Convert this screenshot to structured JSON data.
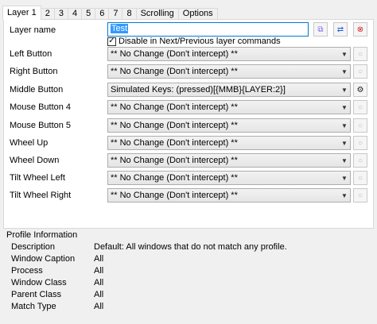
{
  "tabs": [
    "Layer 1",
    "2",
    "3",
    "4",
    "5",
    "6",
    "7",
    "8",
    "Scrolling",
    "Options"
  ],
  "layer_name": {
    "label": "Layer name",
    "value": "Test"
  },
  "disable_checkbox": {
    "label": "Disable in Next/Previous layer commands",
    "checked": "✓"
  },
  "icons": {
    "copy": "⧉",
    "swap": "⇄",
    "remove": "⊗",
    "gear": "⚙",
    "settings_dim": "○",
    "dropdown": "▼"
  },
  "buttons": [
    {
      "label": "Left Button",
      "value": "** No Change (Don't intercept) **"
    },
    {
      "label": "Right Button",
      "value": "** No Change (Don't intercept) **"
    },
    {
      "label": "Middle Button",
      "value": "Simulated Keys: (pressed)[{MMB}{LAYER:2}]"
    },
    {
      "label": "Mouse Button 4",
      "value": "** No Change (Don't intercept) **"
    },
    {
      "label": "Mouse Button 5",
      "value": "** No Change (Don't intercept) **"
    },
    {
      "label": "Wheel Up",
      "value": "** No Change (Don't intercept) **"
    },
    {
      "label": "Wheel Down",
      "value": "** No Change (Don't intercept) **"
    },
    {
      "label": "Tilt Wheel Left",
      "value": "** No Change (Don't intercept) **"
    },
    {
      "label": "Tilt Wheel Right",
      "value": "** No Change (Don't intercept) **"
    }
  ],
  "profile": {
    "title": "Profile Information",
    "rows": [
      {
        "key": "Description",
        "value": "Default: All windows that do not match any profile."
      },
      {
        "key": "Window Caption",
        "value": "All"
      },
      {
        "key": "Process",
        "value": "All"
      },
      {
        "key": "Window Class",
        "value": "All"
      },
      {
        "key": "Parent Class",
        "value": "All"
      },
      {
        "key": "Match Type",
        "value": "All"
      }
    ]
  },
  "colors": {
    "copy_icon": "#7b68ee",
    "swap_icon": "#1e5fd8",
    "remove_icon": "#d22020",
    "selection": "#3399ff"
  }
}
